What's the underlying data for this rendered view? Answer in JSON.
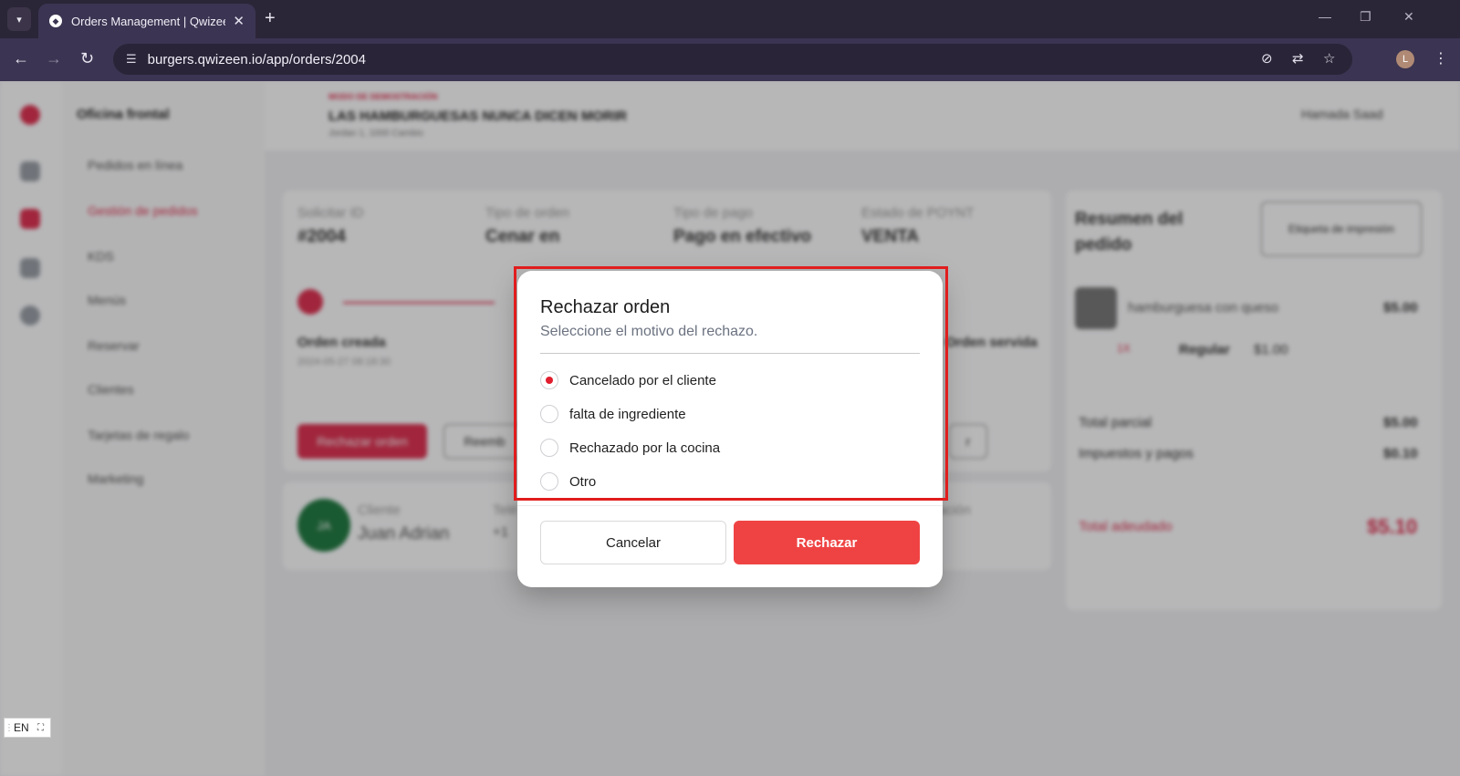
{
  "browser": {
    "tab_title": "Orders Management | Qwizeen",
    "url": "burgers.qwizeen.io/app/orders/2004",
    "profile_initial": "L",
    "icons": [
      "tab-search-icon",
      "favicon-icon",
      "close-icon",
      "new-tab-icon",
      "minimize-icon",
      "restore-icon",
      "window-close-icon",
      "back-icon",
      "forward-icon",
      "reload-icon",
      "site-info-icon",
      "eye-off-icon",
      "translate-icon",
      "star-icon",
      "kebab-menu-icon"
    ]
  },
  "background": {
    "sidebar_title": "Oficina frontal",
    "sidebar_items": [
      "Pedidos en línea",
      "Gestión de pedidos",
      "KDS",
      "Menús",
      "Reservar",
      "Clientes",
      "Tarjetas de regalo",
      "Marketing"
    ],
    "topbar": {
      "small_label": "MODO DE DEMOSTRACIÓN",
      "title": "LAS HAMBURGUESAS NUNCA DICEN MORIR",
      "subtitle": "Jordan 1, 1000 Cambio",
      "user": "Hamada Saad"
    },
    "order_info": [
      {
        "label": "Solicitar ID",
        "value": "#2004"
      },
      {
        "label": "Tipo de orden",
        "value": "Cenar en"
      },
      {
        "label": "Tipo de pago",
        "value": "Pago en efectivo"
      },
      {
        "label": "Estado de POYNT",
        "value": "VENTA"
      }
    ],
    "timeline": {
      "created_label": "Orden creada",
      "created_date": "2024-05-27 08:18:30",
      "served_label": "Orden servida"
    },
    "buttons": {
      "reject": "Rechazar orden",
      "refund": "Reemb",
      "extra": "r"
    },
    "customer": {
      "initials": "JA",
      "label": "Cliente",
      "name": "Juan Adrian",
      "phone_label": "Telé",
      "phone_value": "+1",
      "extra_label": "ación"
    },
    "summary": {
      "title": "Resumen del pedido",
      "print_label": "Etiqueta de impresión",
      "item_name": "hamburguesa con queso",
      "item_price": "$5.00",
      "item_qty": "1X",
      "item_size": "Regular",
      "item_size_price": "$1.00",
      "subtotal_label": "Total parcial",
      "subtotal_value": "$5.00",
      "tax_label": "Impuestos y pagos",
      "tax_value": "$0.10",
      "total_label": "Total adeudado",
      "total_value": "$5.10"
    }
  },
  "modal": {
    "title": "Rechazar orden",
    "subtitle": "Seleccione el motivo del rechazo.",
    "options": [
      {
        "label": "Cancelado por el cliente",
        "checked": true
      },
      {
        "label": "falta de ingrediente",
        "checked": false
      },
      {
        "label": "Rechazado por la cocina",
        "checked": false
      },
      {
        "label": "Otro",
        "checked": false
      }
    ],
    "cancel_label": "Cancelar",
    "reject_label": "Rechazar"
  },
  "language_badge": "EN",
  "colors": {
    "accent": "#ef4343",
    "radio_selected": "#e11d2e",
    "highlight_box": "#e11d1d",
    "brand": "#e0304f"
  }
}
